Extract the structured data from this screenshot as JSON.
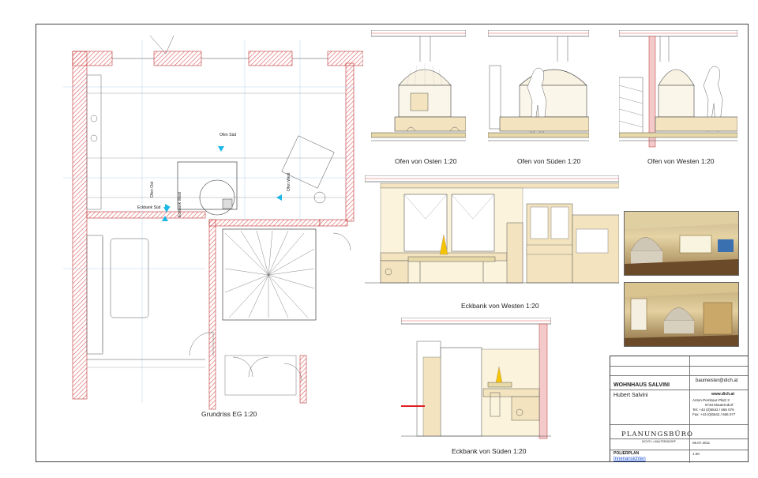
{
  "views": {
    "grundriss": "Grundriss EG  1:20",
    "ofen_osten": "Ofen von Osten  1:20",
    "ofen_sueden": "Ofen von Süden  1:20",
    "ofen_westen": "Ofen von Westen  1:20",
    "eckbank_westen": "Eckbank von Westen  1:20",
    "eckbank_sueden": "Eckbank von Süden  1:20"
  },
  "plan_labels": {
    "ofen_sued": "Ofen Süd",
    "ofen_ost": "Ofen Ost",
    "ofen_west": "Ofen West",
    "eckbank_sued": "Eckbank Süd",
    "eckbank_west": "Eckbank West"
  },
  "title_block": {
    "project": "WOHNHAUS SALVINI",
    "owner": "Hubert Salvini",
    "email": "baumeister@dich.at",
    "website": "www.dich.at",
    "addr1": "Anton-Pembaur-Platz 3",
    "addr2": "5733 Mauterndorf",
    "tel": "Tel: +43 (0)6542 / 666 076",
    "fax": "Fax: +43 (0)6542 / 666 077",
    "firm": "PLANUNGSBÜRO",
    "firm_sub": "DICHTL • MAUTERNDORF",
    "plantype": "POLIERPLAN",
    "plantitle": "Innenansichten",
    "date": "06.07.2011",
    "scale": "1:20"
  },
  "colors": {
    "wall_hatch": "#e15a5a",
    "wood": "#f3e4bf",
    "marker": "#1eb7e6",
    "red_line": "#e02020"
  }
}
